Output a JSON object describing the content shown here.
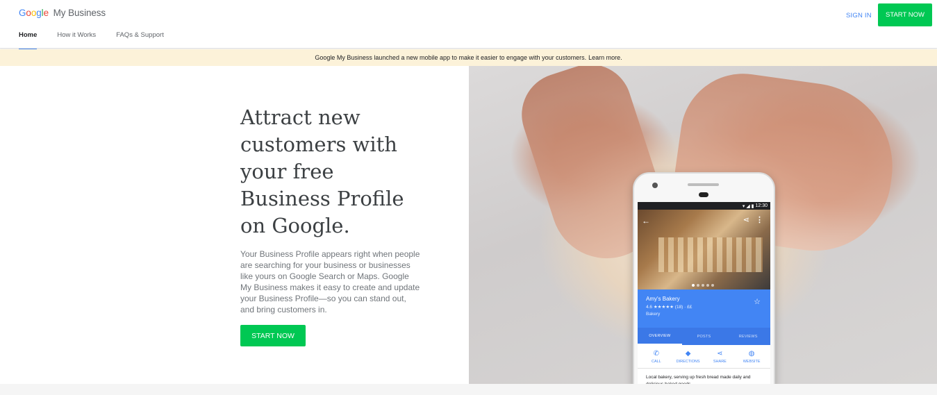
{
  "header": {
    "logo": {
      "google_letters": [
        {
          "ch": "G",
          "color": "#4285f4"
        },
        {
          "ch": "o",
          "color": "#ea4335"
        },
        {
          "ch": "o",
          "color": "#fbbc05"
        },
        {
          "ch": "g",
          "color": "#4285f4"
        },
        {
          "ch": "l",
          "color": "#34a853"
        },
        {
          "ch": "e",
          "color": "#ea4335"
        }
      ],
      "product": "My Business"
    },
    "nav": [
      {
        "label": "Home",
        "active": true
      },
      {
        "label": "How it Works",
        "active": false
      },
      {
        "label": "FAQs & Support",
        "active": false
      }
    ],
    "sign_in": "SIGN IN",
    "start_now": "START NOW"
  },
  "banner": {
    "text": "Google My Business launched a new mobile app to make it easier to engage with your customers.",
    "link": "Learn more."
  },
  "hero": {
    "title": "Attract new\ncustomers with\nyour free\nBusiness Profile\non Google.",
    "description": "Your Business Profile appears right when people are searching for your business or businesses like yours on Google Search or Maps. Google My Business makes it easy to create and update your Business Profile—so you can stand out, and bring customers in.",
    "cta": "START NOW"
  },
  "phone": {
    "time": "12:30",
    "business_name": "Amy's Bakery",
    "rating_line": "4.6 ★★★★★ (18) · ££",
    "category": "Bakery",
    "tabs": [
      "OVERVIEW",
      "POSTS",
      "REVIEWS"
    ],
    "actions": [
      {
        "label": "CALL",
        "icon": "phone-icon"
      },
      {
        "label": "DIRECTIONS",
        "icon": "directions-icon"
      },
      {
        "label": "SHARE",
        "icon": "share-icon"
      },
      {
        "label": "WEBSITE",
        "icon": "globe-icon"
      }
    ],
    "description": "Local bakery, serving up fresh bread made daily and delicious baked goods."
  },
  "colors": {
    "accent_green": "#00c853",
    "google_blue": "#4285f4",
    "banner_bg": "#fcf2d9"
  }
}
